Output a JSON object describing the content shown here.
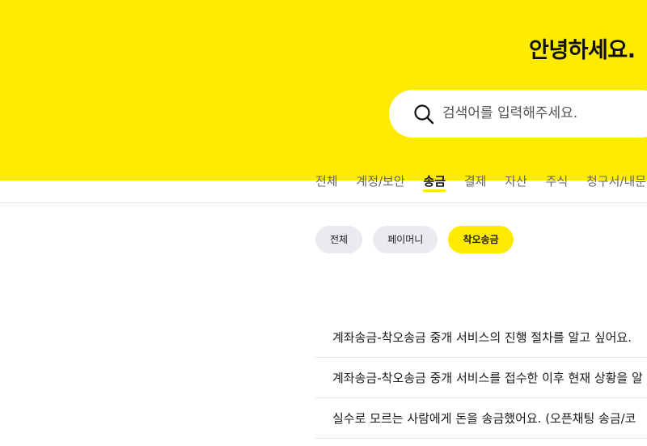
{
  "hero": {
    "greeting": "안녕하세요.",
    "background_color": "#ffeb00"
  },
  "search": {
    "icon": "search-icon",
    "placeholder": "검색어를 입력해주세요.",
    "value": ""
  },
  "category_tabs": [
    {
      "label": "전체",
      "active": false
    },
    {
      "label": "계정/보안",
      "active": false
    },
    {
      "label": "송금",
      "active": true
    },
    {
      "label": "결제",
      "active": false
    },
    {
      "label": "자산",
      "active": false
    },
    {
      "label": "주식",
      "active": false
    },
    {
      "label": "청구서/내문",
      "active": false
    }
  ],
  "sub_filters": [
    {
      "label": "전체",
      "active": false
    },
    {
      "label": "페이머니",
      "active": false
    },
    {
      "label": "착오송금",
      "active": true
    }
  ],
  "faq_items": [
    "계좌송금-착오송금 중개 서비스의 진행 절차를 알고 싶어요.",
    "계좌송금-착오송금 중개 서비스를 접수한 이후 현재 상황을 알",
    "실수로 모르는 사람에게 돈을 송금했어요. (오픈채팅 송금/코"
  ]
}
